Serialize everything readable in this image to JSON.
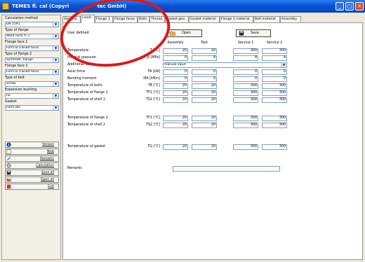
{
  "window": {
    "title": "TEMES fl. cal (Copyri",
    "title_tail": "tec GmbH)",
    "minimize": "_",
    "maximize": "□",
    "close": "✕"
  },
  "left": {
    "calc_method_label": "Calculation method",
    "calc_method_value": "EN 1591",
    "flange_type_label": "Type of flange",
    "flange_type_value": "Weld neck fl. c",
    "face1_label": "Flange face 1",
    "face1_value": "Form B (raised face)",
    "flange_type2_label": "Type of flange 2",
    "flange_type2_value": "Symmetr. flange",
    "face2_label": "Flange face 2",
    "face2_value": "Form B (raised face)",
    "bolt_type_label": "Type of bolt",
    "bolt_type_value": "screw",
    "bushing_label": "Expansion bushing",
    "bushing_value": "no",
    "gasket_label": "Gasket",
    "gasket_value": "Form IBC",
    "buttons": [
      {
        "label": "Version",
        "icon": "info-icon"
      },
      {
        "label": "New",
        "icon": "new-document-icon"
      },
      {
        "label": "Remarks",
        "icon": "remarks-icon"
      },
      {
        "label": "Calculation",
        "icon": "calculation-icon"
      },
      {
        "label": "Save all",
        "icon": "save-icon"
      },
      {
        "label": "Open all",
        "icon": "open-icon"
      },
      {
        "label": "Exit",
        "icon": "exit-icon"
      }
    ]
  },
  "tabs": [
    "General",
    "Loads",
    "Flange 1",
    "Flange faces",
    "Bolts",
    "Thread",
    "Gasket geo.",
    "Gasket material",
    "Flange 1 material",
    "Bolt material",
    "Assembly"
  ],
  "active_tab": "Loads",
  "panel": {
    "user_defined": "User defined",
    "open_label": "Open",
    "save_label": "Save",
    "columns": [
      "Assembly",
      "Test",
      "Service 1",
      "Service 2"
    ],
    "rows": [
      {
        "label": "Temperature",
        "unit": "T [°C]",
        "values": [
          "20",
          "20",
          "300",
          "300"
        ]
      },
      {
        "label": "Internal pressure",
        "unit": "p [MPa]",
        "values": [
          "0",
          "4",
          "4",
          "4"
        ]
      },
      {
        "label": "Axial force",
        "unit": "FA [kN]",
        "values": [
          "0",
          "0",
          "0",
          "0"
        ]
      },
      {
        "label": "Bending moment",
        "unit": "MA [kNm]",
        "values": [
          "0",
          "0",
          "0",
          "0"
        ]
      },
      {
        "label": "Temperature of bolts",
        "unit": "TB [°C]",
        "values": [
          "20",
          "20",
          "300",
          "300"
        ]
      },
      {
        "label": "Temperature of flange 1",
        "unit": "TF1 [°C]",
        "values": [
          "20",
          "20",
          "300",
          "300"
        ]
      },
      {
        "label": "Temperature of shell 1",
        "unit": "TS1 [°C]",
        "values": [
          "20",
          "20",
          "300",
          "300"
        ]
      },
      {
        "label": "Temperature of flange 2",
        "unit": "TF2 [°C]",
        "values": [
          "20",
          "20",
          "300",
          "300"
        ]
      },
      {
        "label": "Temperature of shell 2",
        "unit": "TS2 [°C]",
        "values": [
          "20",
          "20",
          "300",
          "300"
        ]
      },
      {
        "label": "Temperature of gasket",
        "unit": "TG [°C]",
        "values": [
          "20",
          "20",
          "300",
          "300"
        ]
      }
    ],
    "additional_loads_label": "Additional loads",
    "additional_loads_value": "manual input",
    "remarks_label": "Remarks",
    "remarks_value": ""
  },
  "colors": {
    "annotation_ring": "#e01818",
    "titlebar": "#0a52d6"
  }
}
